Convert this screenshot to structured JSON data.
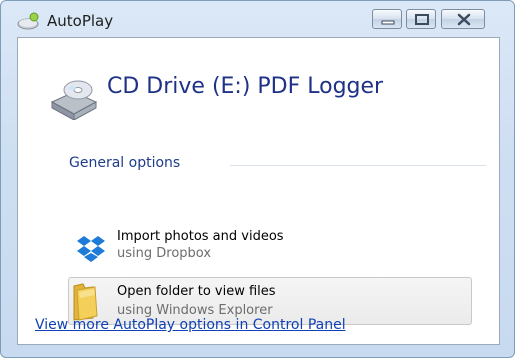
{
  "window": {
    "title": "AutoPlay"
  },
  "device": {
    "title": "CD Drive (E:) PDF Logger",
    "icon": "cd-drive-icon"
  },
  "general_options": {
    "label": "General options",
    "items": [
      {
        "label": "Import photos and videos",
        "sublabel": "using Dropbox",
        "icon": "dropbox-icon"
      },
      {
        "label": "Open folder to view files",
        "sublabel": "using Windows Explorer",
        "icon": "folder-icon",
        "state": "hover"
      }
    ]
  },
  "footer": {
    "link": "View more AutoPlay options in Control Panel"
  },
  "colors": {
    "title_blue": "#1e3287",
    "link_blue": "#0f40b6",
    "dropbox_blue": "#1e7bd8",
    "folder_yellow": "#f4cf5a"
  }
}
